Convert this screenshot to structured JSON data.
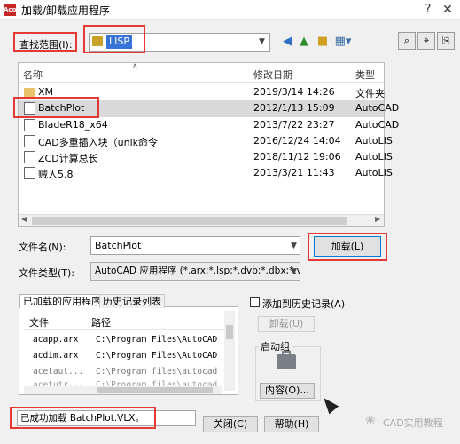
{
  "window": {
    "logo_text": "Aco",
    "title": "加载/卸载应用程序",
    "help_glyph": "?",
    "close_glyph": "✕"
  },
  "lookin": {
    "label": "查找范围(I):",
    "value": "LISP"
  },
  "filelist": {
    "headers": {
      "name": "名称",
      "date": "修改日期",
      "type": "类型"
    },
    "rows": [
      {
        "name": "XM",
        "date": "2019/3/14 14:26",
        "type": "文件夹"
      },
      {
        "name": "BatchPlot",
        "date": "2012/1/13 15:09",
        "type": "AutoCAD"
      },
      {
        "name": "BladeR18_x64",
        "date": "2013/7/22 23:27",
        "type": "AutoCAD"
      },
      {
        "name": "CAD多重插入块（unlk命令",
        "date": "2016/12/24 14:04",
        "type": "AutoLIS"
      },
      {
        "name": "ZCD计算总长",
        "date": "2018/11/12 19:06",
        "type": "AutoLIS"
      },
      {
        "name": "贼人5.8",
        "date": "2013/3/21 11:43",
        "type": "AutoLIS"
      }
    ]
  },
  "filename": {
    "label": "文件名(N):",
    "value": "BatchPlot"
  },
  "filetype": {
    "label": "文件类型(T):",
    "value": "AutoCAD 应用程序 (*.arx;*.lsp;*.dvb;*.dbx;*.vlx"
  },
  "load_button": "加载(L)",
  "tabs": {
    "loaded": "已加载的应用程序",
    "history": "历史记录列表"
  },
  "loaded_apps": {
    "headers": {
      "file": "文件",
      "path": "路径"
    },
    "rows": [
      {
        "file": "acapp.arx",
        "path": "C:\\Program Files\\AutoCAD"
      },
      {
        "file": "acdim.arx",
        "path": "C:\\Program Files\\AutoCAD"
      },
      {
        "file": "acetaut...",
        "path": "C:\\Program files\\autocad"
      },
      {
        "file": "acetutr...",
        "path": "C:\\Program files\\autocad"
      }
    ]
  },
  "add_history": "添加到历史记录(A)",
  "unload_button": "卸载(U)",
  "startup": {
    "label": "启动组",
    "contents_button": "内容(O)..."
  },
  "status": "已成功加载 BatchPlot.VLX。",
  "close_button": "关闭(C)",
  "help_button": "帮助(H)",
  "watermark": "CAD实用教程"
}
